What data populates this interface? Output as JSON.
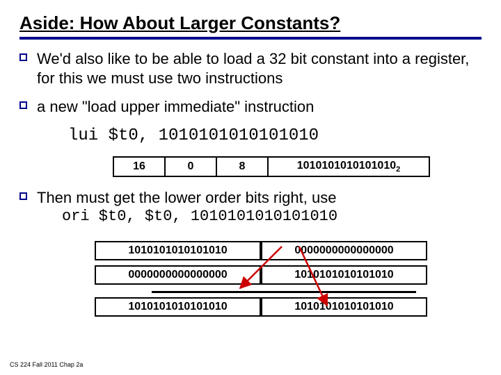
{
  "title": "Aside:  How About Larger Constants?",
  "bullets": {
    "b1": "We'd also like to be able to load a 32 bit constant into a register, for this we must use two instructions",
    "b2": "a new \"load upper immediate\" instruction",
    "b3_line1": "Then must get the lower order bits right, use"
  },
  "code": {
    "lui": "lui $t0, 1010101010101010",
    "ori": "ori $t0, $t0, 1010101010101010"
  },
  "encoding": {
    "op": "16",
    "rs": "0",
    "rt": "8",
    "imm": "1010101010101010",
    "imm_sub": "2"
  },
  "registers": {
    "r1_hi": "1010101010101010",
    "r1_lo": "0000000000000000",
    "r2_hi": "0000000000000000",
    "r2_lo": "1010101010101010",
    "r3_hi": "1010101010101010",
    "r3_lo": "1010101010101010"
  },
  "footer": "CS 224 Fall 2011 Chap 2a",
  "colors": {
    "accent": "#00008b",
    "arrow": "#cc0000"
  }
}
